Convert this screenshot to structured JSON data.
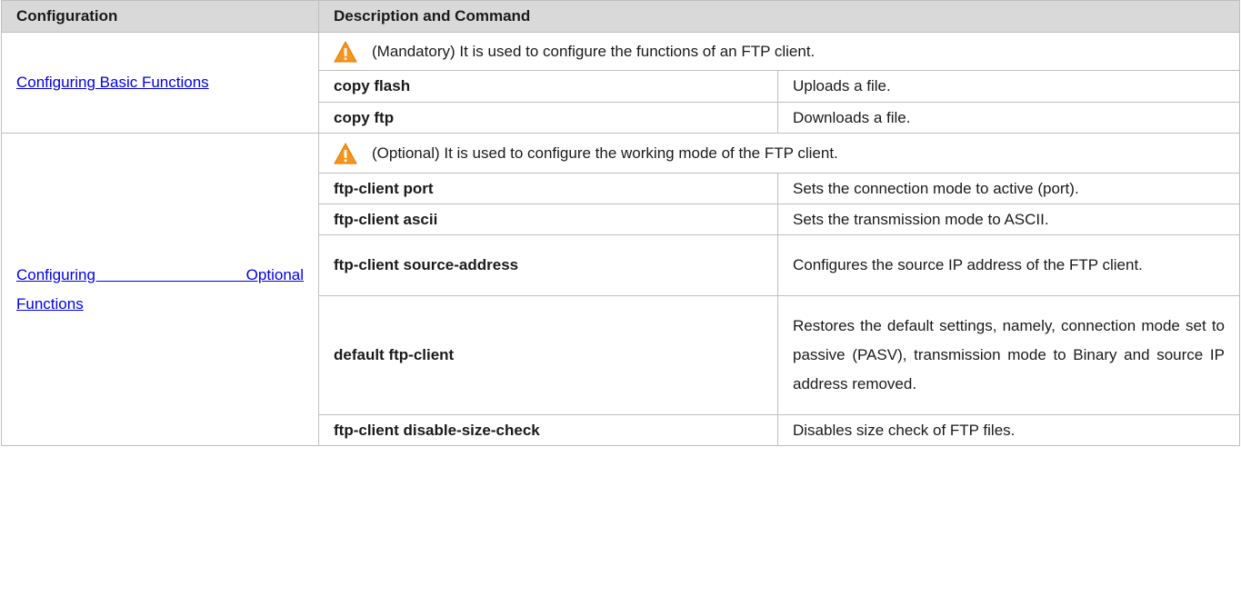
{
  "headers": {
    "configuration": "Configuration",
    "description": "Description and Command"
  },
  "groups": [
    {
      "link": "Configuring Basic Functions",
      "note": "(Mandatory) It is used to configure the functions of an FTP client.",
      "rows": [
        {
          "command": "copy flash",
          "description": "Uploads a file."
        },
        {
          "command": "copy ftp",
          "description": "Downloads a file."
        }
      ]
    },
    {
      "link_line1": "Configuring Optional",
      "link_line2": "Functions",
      "note": "(Optional) It is used to configure the working mode of the FTP client.",
      "rows": [
        {
          "command": "ftp-client port",
          "description": "Sets the connection mode to active (port)."
        },
        {
          "command": "ftp-client ascii",
          "description": "Sets the transmission mode to ASCII."
        },
        {
          "command": "ftp-client source-address",
          "description": "Configures the source IP address of the FTP client."
        },
        {
          "command": "default ftp-client",
          "description": "Restores the default settings, namely, connection mode set to passive (PASV), transmission mode to Binary and source IP address removed."
        },
        {
          "command": "ftp-client disable-size-check",
          "description": "Disables size check of FTP files."
        }
      ]
    }
  ],
  "icons": {
    "warning": "warning-triangle-icon"
  },
  "colors": {
    "header_bg": "#d9d9d9",
    "link": "#0000ee",
    "warning_fill": "#f7941d"
  }
}
